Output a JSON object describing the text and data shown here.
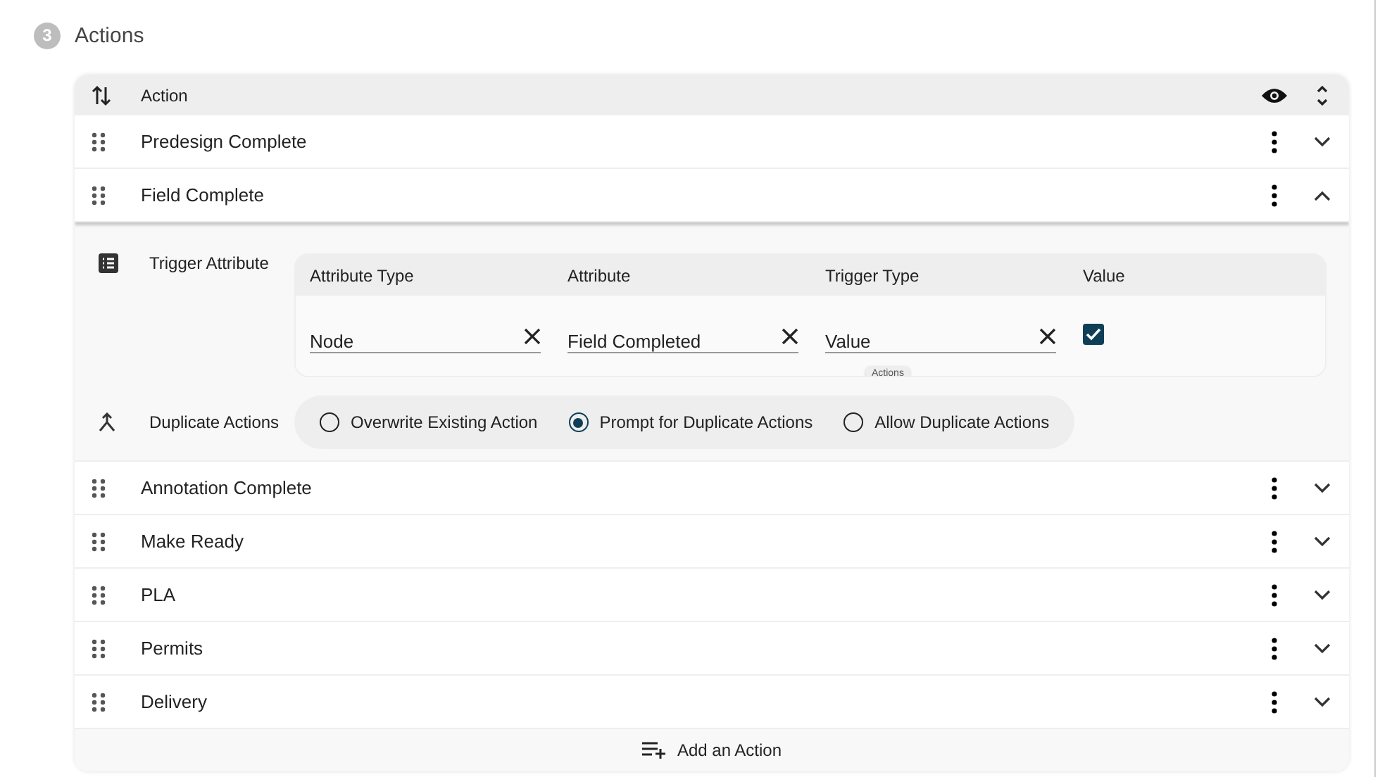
{
  "section": {
    "step": "3",
    "title": "Actions"
  },
  "table": {
    "header": {
      "label": "Action"
    },
    "rows": [
      {
        "label": "Predesign Complete",
        "expanded": false
      },
      {
        "label": "Field Complete",
        "expanded": true,
        "detail": {
          "trigger": {
            "label": "Trigger Attribute",
            "columns": [
              "Attribute Type",
              "Attribute",
              "Trigger Type",
              "Value"
            ],
            "fields": [
              "Node",
              "Field Completed",
              "Value"
            ],
            "checked": true,
            "tooltip": "Actions"
          },
          "duplicate": {
            "label": "Duplicate Actions",
            "options": [
              {
                "label": "Overwrite Existing Action",
                "selected": false
              },
              {
                "label": "Prompt for Duplicate Actions",
                "selected": true
              },
              {
                "label": "Allow Duplicate Actions",
                "selected": false
              }
            ]
          }
        }
      },
      {
        "label": "Annotation Complete",
        "expanded": false
      },
      {
        "label": "Make Ready",
        "expanded": false
      },
      {
        "label": "PLA",
        "expanded": false
      },
      {
        "label": "Permits",
        "expanded": false
      },
      {
        "label": "Delivery",
        "expanded": false
      }
    ]
  },
  "add_button": {
    "label": "Add an Action"
  }
}
